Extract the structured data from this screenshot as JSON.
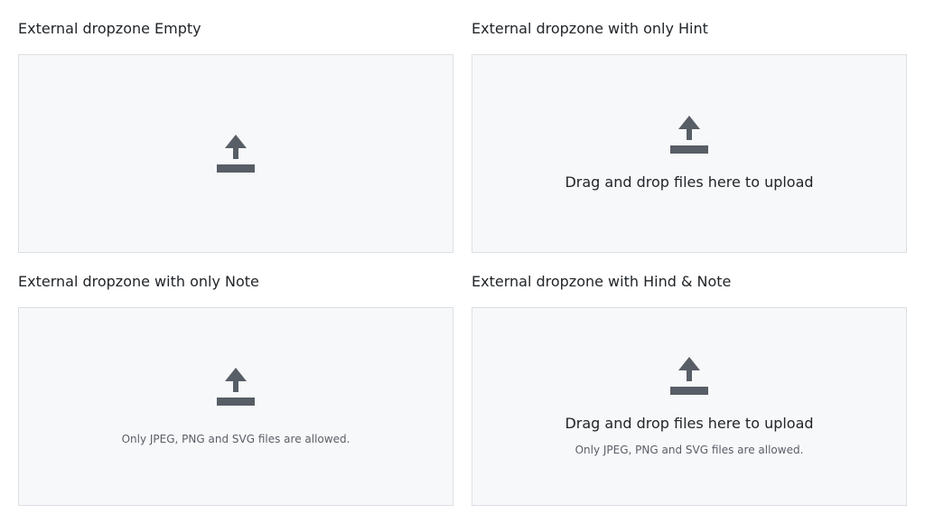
{
  "colors": {
    "dropzone_background": "#f7f8fa",
    "dropzone_border": "#dcdfe3",
    "icon": "#585e66",
    "text": "#212529",
    "note_text": "#5a5f66"
  },
  "icons": {
    "upload": "upload-icon"
  },
  "sections": [
    {
      "title": "External dropzone Empty"
    },
    {
      "title": "External dropzone with only Hint",
      "hint": "Drag and drop files here to upload"
    },
    {
      "title": "External dropzone with only Note",
      "note": "Only JPEG, PNG and SVG files are allowed."
    },
    {
      "title": "External dropzone with Hind & Note",
      "hint": "Drag and drop files here to upload",
      "note": "Only JPEG, PNG and SVG files are allowed."
    }
  ]
}
